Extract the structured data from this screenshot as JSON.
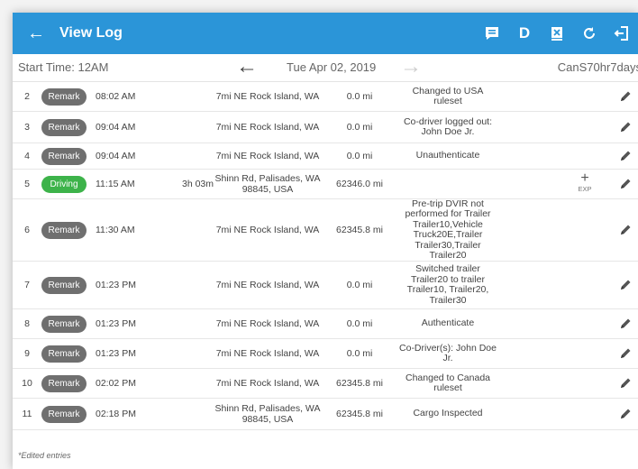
{
  "app": {
    "title": "View Log"
  },
  "subbar": {
    "start_time": "Start Time: 12AM",
    "date": "Tue Apr 02, 2019",
    "ruleset": "CanS70hr7days"
  },
  "icons": {
    "back": "arrow-left-icon",
    "actions": [
      "document-comment-icon",
      "d-letter-icon",
      "close-doc-icon",
      "refresh-icon",
      "logout-icon"
    ],
    "edit": "pencil-icon",
    "add": "plus-icon"
  },
  "colors": {
    "appbar": "#2b95d8",
    "remark": "#6f6f6f",
    "driving": "#3db34a"
  },
  "actions": {
    "d_label": "D"
  },
  "entries": [
    {
      "num": "2",
      "type": "Remark",
      "time": "08:02 AM",
      "duration": "",
      "location": [
        "7mi NE Rock Island, WA"
      ],
      "odometer": "0.0 mi",
      "note": [
        "Changed to USA",
        "ruleset"
      ],
      "exp": ""
    },
    {
      "num": "3",
      "type": "Remark",
      "time": "09:04 AM",
      "duration": "",
      "location": [
        "7mi NE Rock Island, WA"
      ],
      "odometer": "0.0 mi",
      "note": [
        "Co-driver logged out:",
        "John Doe Jr."
      ],
      "exp": ""
    },
    {
      "num": "4",
      "type": "Remark",
      "time": "09:04 AM",
      "duration": "",
      "location": [
        "7mi NE Rock Island, WA"
      ],
      "odometer": "0.0 mi",
      "note": [
        "Unauthenticate"
      ],
      "exp": ""
    },
    {
      "num": "5",
      "type": "Driving",
      "time": "11:15 AM",
      "duration": "3h 03m",
      "location": [
        "Shinn Rd, Palisades, WA",
        "98845, USA"
      ],
      "odometer": "62346.0 mi",
      "note": [],
      "exp": "EXP"
    },
    {
      "num": "6",
      "type": "Remark",
      "time": "11:30 AM",
      "duration": "",
      "location": [
        "7mi NE Rock Island, WA"
      ],
      "odometer": "62345.8 mi",
      "note": [
        "Pre-trip DVIR not",
        "performed for Trailer",
        "Trailer10,Vehicle",
        "Truck20E,Trailer",
        "Trailer30,Trailer",
        "Trailer20"
      ],
      "exp": ""
    },
    {
      "num": "7",
      "type": "Remark",
      "time": "01:23 PM",
      "duration": "",
      "location": [
        "7mi NE Rock Island, WA"
      ],
      "odometer": "0.0 mi",
      "note": [
        "Switched trailer",
        "Trailer20 to trailer",
        "Trailer10, Trailer20,",
        "Trailer30"
      ],
      "exp": ""
    },
    {
      "num": "8",
      "type": "Remark",
      "time": "01:23 PM",
      "duration": "",
      "location": [
        "7mi NE Rock Island, WA"
      ],
      "odometer": "0.0 mi",
      "note": [
        "Authenticate"
      ],
      "exp": ""
    },
    {
      "num": "9",
      "type": "Remark",
      "time": "01:23 PM",
      "duration": "",
      "location": [
        "7mi NE Rock Island, WA"
      ],
      "odometer": "0.0 mi",
      "note": [
        "Co-Driver(s): John Doe",
        "Jr."
      ],
      "exp": ""
    },
    {
      "num": "10",
      "type": "Remark",
      "time": "02:02 PM",
      "duration": "",
      "location": [
        "7mi NE Rock Island, WA"
      ],
      "odometer": "62345.8 mi",
      "note": [
        "Changed to Canada",
        "ruleset"
      ],
      "exp": ""
    },
    {
      "num": "11",
      "type": "Remark",
      "time": "02:18 PM",
      "duration": "",
      "location": [
        "Shinn Rd, Palisades, WA",
        "98845, USA"
      ],
      "odometer": "62345.8 mi",
      "note": [
        "Cargo Inspected"
      ],
      "exp": ""
    }
  ],
  "footer": {
    "note": "*Edited entries"
  }
}
